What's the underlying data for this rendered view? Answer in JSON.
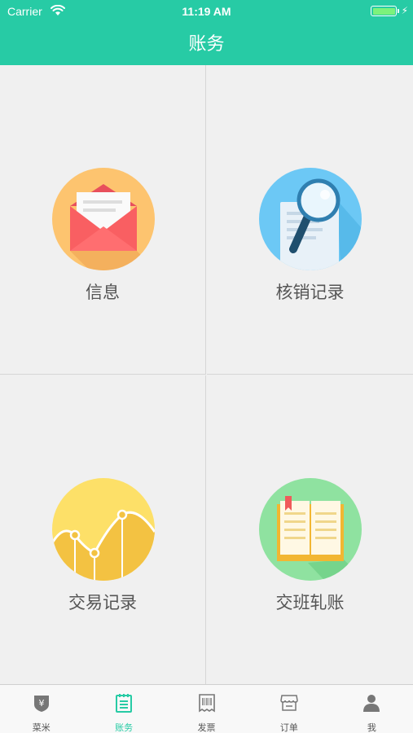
{
  "status": {
    "carrier": "Carrier",
    "time": "11:19 AM"
  },
  "nav": {
    "title": "账务"
  },
  "tiles": [
    {
      "label": "信息",
      "icon": "envelope-icon"
    },
    {
      "label": "核销记录",
      "icon": "magnifier-document-icon"
    },
    {
      "label": "交易记录",
      "icon": "line-chart-icon"
    },
    {
      "label": "交班轧账",
      "icon": "open-book-icon"
    }
  ],
  "tabs": [
    {
      "label": "菜米",
      "icon": "yen-shield-icon",
      "active": false
    },
    {
      "label": "账务",
      "icon": "notepad-icon",
      "active": true
    },
    {
      "label": "发票",
      "icon": "barcode-receipt-icon",
      "active": false
    },
    {
      "label": "订单",
      "icon": "storefront-icon",
      "active": false
    },
    {
      "label": "我",
      "icon": "person-icon",
      "active": false
    }
  ],
  "colors": {
    "accent": "#27cba5",
    "background": "#f0f0f0",
    "divider": "#d6d6d6"
  }
}
